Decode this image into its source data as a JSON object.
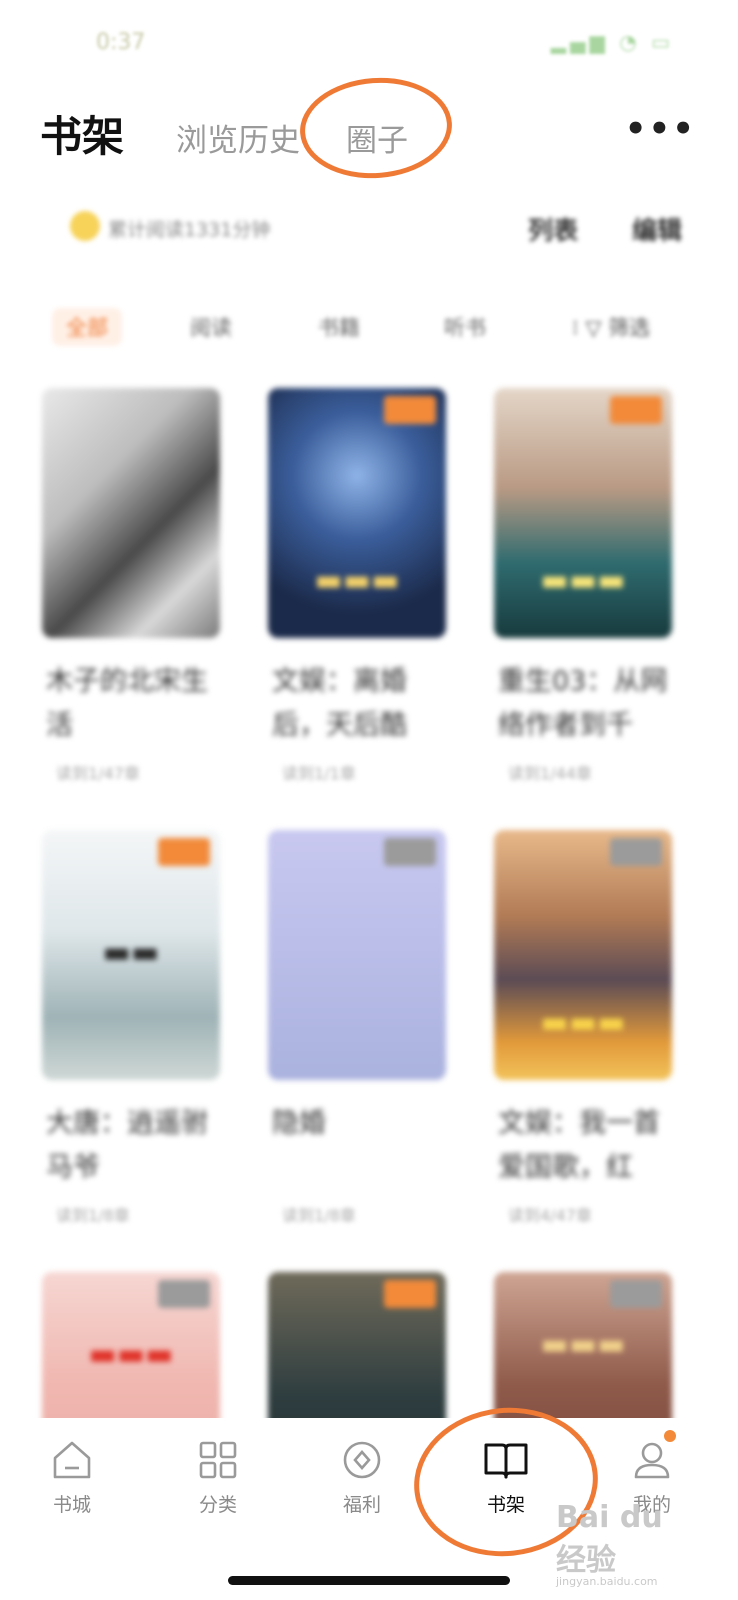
{
  "status_bar": {
    "time": "0:37",
    "icons": "signal-wifi-battery"
  },
  "header": {
    "tabs": [
      {
        "label": "书架",
        "active": true
      },
      {
        "label": "浏览历史",
        "active": false
      },
      {
        "label": "圈子",
        "active": false
      }
    ],
    "more_icon": "more-horizontal-icon"
  },
  "reading_summary": {
    "text": "累计阅读1331分钟",
    "list_button": "列表",
    "edit_button": "编辑"
  },
  "filters": {
    "chips": [
      "全部",
      "阅读",
      "书籍",
      "听书"
    ],
    "filter_label": "筛选",
    "active_index": 0
  },
  "books": [
    {
      "title": "木子的北宋生活",
      "progress": "读到1/47章",
      "badge": "",
      "palette": "mono"
    },
    {
      "title": "文娱：离婚后，天后酷",
      "progress": "读到1/1章",
      "badge": "orange",
      "palette": "blue"
    },
    {
      "title": "重生03：从网络作者到千",
      "progress": "读到1/44章",
      "badge": "orange",
      "palette": "teal"
    },
    {
      "title": "大唐：逍遥驸马爷",
      "progress": "读到1/8章",
      "badge": "orange",
      "palette": "white"
    },
    {
      "title": "隐婚",
      "progress": "读到1/8章",
      "badge": "gray",
      "palette": "lavender"
    },
    {
      "title": "文娱：我一首爱国歌，红",
      "progress": "读到4/47章",
      "badge": "gray",
      "palette": "warm"
    },
    {
      "title": "",
      "progress": "",
      "badge": "gray",
      "palette": "pink"
    },
    {
      "title": "",
      "progress": "",
      "badge": "orange",
      "palette": "dark"
    },
    {
      "title": "",
      "progress": "",
      "badge": "gray",
      "palette": "brown"
    }
  ],
  "bottom_nav": [
    {
      "label": "书城",
      "icon": "home-icon",
      "active": false
    },
    {
      "label": "分类",
      "icon": "grid-icon",
      "active": false
    },
    {
      "label": "福利",
      "icon": "coin-icon",
      "active": false
    },
    {
      "label": "书架",
      "icon": "book-open-icon",
      "active": true
    },
    {
      "label": "我的",
      "icon": "user-icon",
      "active": false
    }
  ],
  "watermark": {
    "logo": "Bai du 经验",
    "sub": "jingyan.baidu.com"
  },
  "colors": {
    "accent": "#ef7a35",
    "active_text": "#111111",
    "inactive_text": "#9a9a9a"
  }
}
